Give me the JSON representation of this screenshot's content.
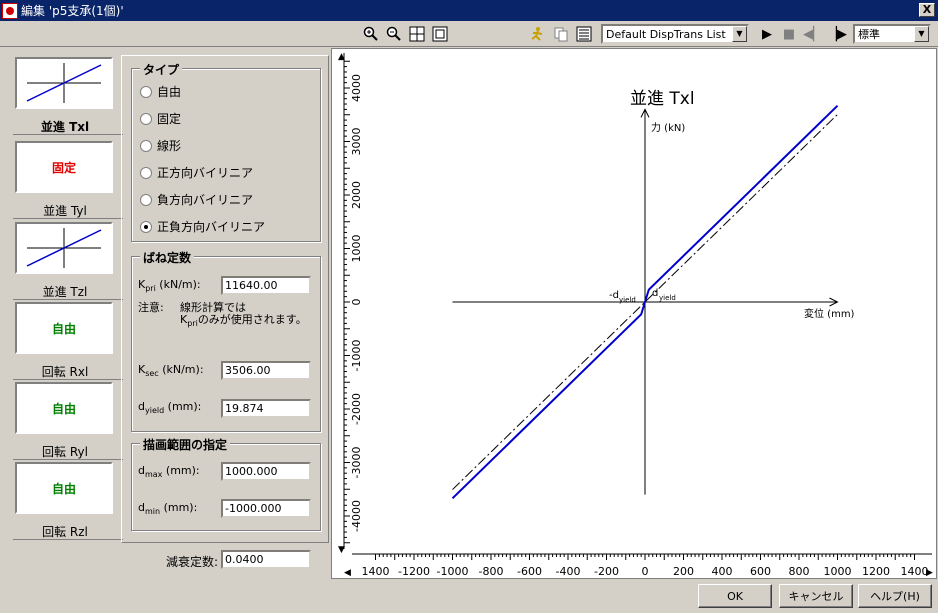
{
  "window": {
    "title": "編集 'p5支承(1個)'",
    "close_label": "X"
  },
  "toolbar": {
    "disp_list": "Default DispTrans List",
    "mode": "標準"
  },
  "components": [
    {
      "label": "並進 Txl",
      "state": ""
    },
    {
      "label": "並進 Tyl",
      "state": "固定"
    },
    {
      "label": "並進 Tzl",
      "state": ""
    },
    {
      "label": "回転 Rxl",
      "state": "自由"
    },
    {
      "label": "回転 Ryl",
      "state": "自由"
    },
    {
      "label": "回転 Rzl",
      "state": "自由"
    }
  ],
  "type_group": {
    "title": "タイプ",
    "options": [
      "自由",
      "固定",
      "線形",
      "正方向バイリニア",
      "負方向バイリニア",
      "正負方向バイリニア"
    ],
    "selected": "正負方向バイリニア"
  },
  "spring_group": {
    "title": "ばね定数",
    "kpri_label_main": "K",
    "kpri_label_sub": "pri",
    "kpri_label_unit": " (kN/m):",
    "kpri_value": "11640.00",
    "note_prefix": "注意:",
    "note_line1": "線形計算では",
    "note_line2_k": "K",
    "note_line2_sub": "pri",
    "note_line2_rest": "のみが使用されます。",
    "ksec_label_main": "K",
    "ksec_label_sub": "sec",
    "ksec_label_unit": " (kN/m):",
    "ksec_value": "3506.00",
    "dyield_label_main": "d",
    "dyield_label_sub": "yield",
    "dyield_label_unit": " (mm):",
    "dyield_value": "19.874"
  },
  "range_group": {
    "title": "描画範囲の指定",
    "dmax_label_main": "d",
    "dmax_label_sub": "max",
    "dmax_label_unit": " (mm):",
    "dmax_value": "1000.000",
    "dmin_label_main": "d",
    "dmin_label_sub": "min",
    "dmin_label_unit": " (mm):",
    "dmin_value": "-1000.000"
  },
  "damping": {
    "label": "減衰定数:",
    "value": "0.0400"
  },
  "buttons": {
    "ok": "OK",
    "cancel": "キャンセル",
    "help": "ヘルプ(H)"
  },
  "chart_data": {
    "type": "line",
    "title": "並進 Txl",
    "xlabel": "変位 (mm)",
    "ylabel": "力 (kN)",
    "xlim": [
      -1400,
      1400
    ],
    "ylim": [
      -4500,
      4500
    ],
    "x_ticks": [
      "1400",
      "-1200",
      "-1000",
      "-800",
      "-600",
      "-400",
      "-200",
      "0",
      "200",
      "400",
      "600",
      "800",
      "1000",
      "1200",
      "1400"
    ],
    "y_ticks": [
      "4000",
      "3000",
      "2000",
      "1000",
      "0",
      "-1000",
      "-2000",
      "-3000",
      "-4000"
    ],
    "annotations": [
      "-d",
      "yield",
      "d",
      "yield"
    ],
    "series": [
      {
        "style": "solid",
        "color": "#0000cc",
        "x": [
          -1000,
          -19.874,
          0,
          19.874,
          1000
        ],
        "y": [
          -3669,
          -231,
          0,
          231,
          3669
        ]
      },
      {
        "style": "dashdot",
        "color": "#000000",
        "x": [
          -1000,
          1000
        ],
        "y": [
          -3506,
          3506
        ]
      }
    ]
  }
}
